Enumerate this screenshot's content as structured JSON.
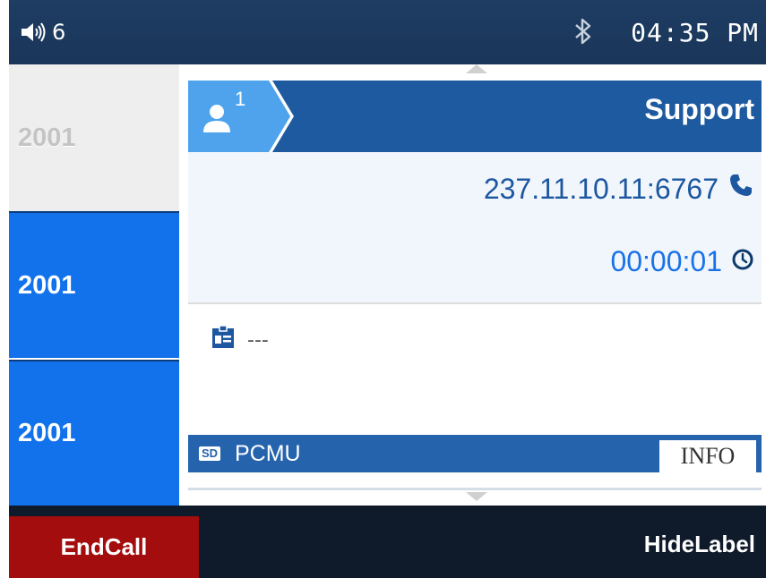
{
  "status_bar": {
    "volume_icon": "speaker-volume-icon",
    "volume_level": "6",
    "bluetooth_icon": "bluetooth-icon",
    "time": "04:35 PM"
  },
  "sidebar": {
    "items": [
      {
        "label": "2001",
        "state": "inactive"
      },
      {
        "label": "2001",
        "state": "active"
      },
      {
        "label": "2001",
        "state": "active"
      }
    ]
  },
  "call": {
    "participant_count": "1",
    "contact_name": "Support",
    "address": "237.11.10.11:6767",
    "duration": "00:00:01",
    "note": "---",
    "sd_badge": "SD",
    "codec": "PCMU",
    "info_label": "INFO"
  },
  "softkeys": {
    "end_call": "EndCall",
    "hide_label": "HideLabel"
  },
  "colors": {
    "status_bar_bg": "#1e3d63",
    "sidebar_active": "#1272ec",
    "header_bg": "#1e5aa0",
    "end_call_bg": "#a30d0d",
    "softkey_bar_bg": "#0f1a2a"
  }
}
